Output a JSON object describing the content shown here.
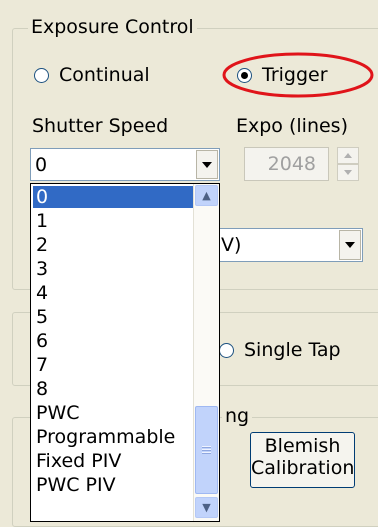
{
  "exposure_group": {
    "title": "Exposure Control",
    "radio_continual": "Continual",
    "radio_trigger": "Trigger",
    "selected_mode": "Trigger",
    "shutter_speed_label": "Shutter Speed",
    "shutter_speed_value": "0",
    "expo_label": "Expo (lines)",
    "expo_value": "2048"
  },
  "second_combo": {
    "visible_fragment": "V)"
  },
  "tap_group": {
    "radio_single_tap": "Single Tap"
  },
  "calibration_group": {
    "title_fragment": "ng",
    "blemish_button_line1": "Blemish",
    "blemish_button_line2": "Calibration"
  },
  "shutter_dropdown": {
    "items": [
      "0",
      "1",
      "2",
      "3",
      "4",
      "5",
      "6",
      "7",
      "8",
      "PWC",
      "Programmable",
      "Fixed PIV",
      "PWC PIV"
    ],
    "selected": "0"
  },
  "annotation": {
    "color": "#e0141a"
  }
}
